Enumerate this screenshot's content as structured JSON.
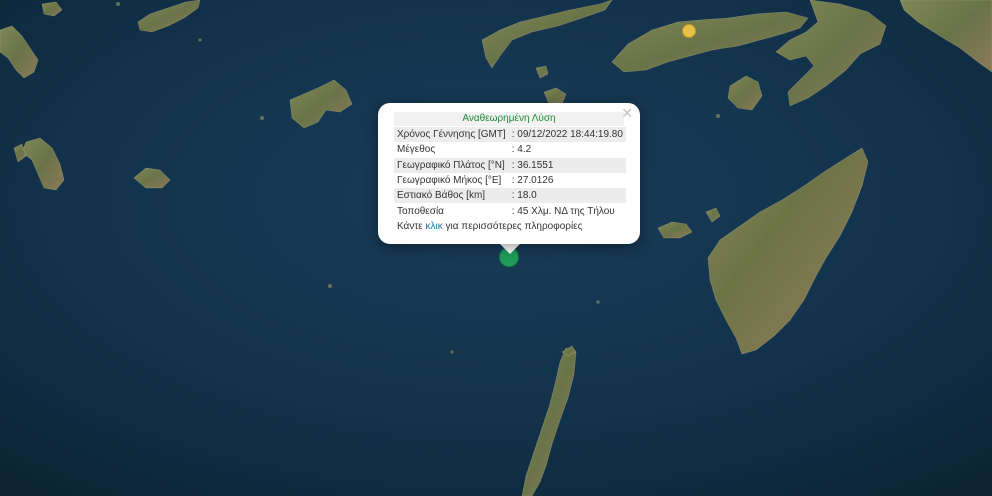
{
  "popup": {
    "title": "Αναθεωρημένη Λύση",
    "close_icon": "close-icon",
    "rows": [
      {
        "label": "Χρόνος Γέννησης [GMT]",
        "value": ": 09/12/2022 18:44:19.80"
      },
      {
        "label": "Μέγεθος",
        "value": ": 4.2"
      },
      {
        "label": "Γεωγραφικό Πλάτος [°N]",
        "value": ": 36.1551"
      },
      {
        "label": "Γεωγραφικό Μήκος [°E]",
        "value": ": 27.0126"
      },
      {
        "label": "Εστιακό Βάθος [km]",
        "value": ": 18.0"
      },
      {
        "label": "Τοποθεσία",
        "value": ": 45 Χλμ. ΝΔ της Τήλου"
      }
    ],
    "footer_before": "Κάντε ",
    "footer_link": "κλικ",
    "footer_after": " για περισσότερες πληροφορίες"
  },
  "colors": {
    "sea": "#12324a",
    "land": "#6e7a4c",
    "quake_marker": "#1f9c5a",
    "yellow_marker": "#e8c14a",
    "title_green": "#21883a"
  }
}
